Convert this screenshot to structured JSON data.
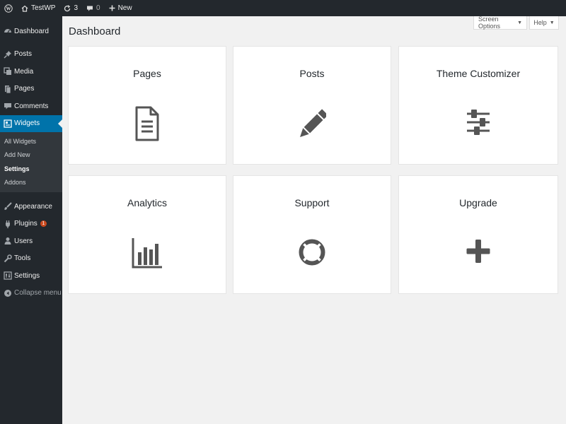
{
  "adminbar": {
    "site_name": "TestWP",
    "updates_count": "3",
    "comments_count": "0",
    "new_label": "New"
  },
  "sidebar": {
    "items_top": [
      {
        "label": "Dashboard",
        "icon": "dashboard-icon"
      },
      {
        "label": "Posts",
        "icon": "pin-icon"
      },
      {
        "label": "Media",
        "icon": "media-icon"
      },
      {
        "label": "Pages",
        "icon": "pages-icon"
      },
      {
        "label": "Comments",
        "icon": "comment-icon"
      },
      {
        "label": "Widgets",
        "icon": "widgets-icon",
        "active": true
      }
    ],
    "submenu": [
      {
        "label": "All Widgets"
      },
      {
        "label": "Add New"
      },
      {
        "label": "Settings",
        "current": true
      },
      {
        "label": "Addons"
      }
    ],
    "items_bottom": [
      {
        "label": "Appearance",
        "icon": "brush-icon"
      },
      {
        "label": "Plugins",
        "icon": "plug-icon",
        "badge": "1"
      },
      {
        "label": "Users",
        "icon": "user-icon"
      },
      {
        "label": "Tools",
        "icon": "wrench-icon"
      },
      {
        "label": "Settings",
        "icon": "settings-icon"
      },
      {
        "label": "Collapse menu",
        "icon": "collapse-icon"
      }
    ]
  },
  "header": {
    "screen_options_label": "Screen Options",
    "help_label": "Help",
    "title": "Dashboard"
  },
  "cards": [
    {
      "title": "Pages",
      "icon": "document-icon"
    },
    {
      "title": "Posts",
      "icon": "pencil-icon"
    },
    {
      "title": "Theme Customizer",
      "icon": "sliders-icon"
    },
    {
      "title": "Analytics",
      "icon": "bar-chart-icon"
    },
    {
      "title": "Support",
      "icon": "lifebuoy-icon"
    },
    {
      "title": "Upgrade",
      "icon": "plus-icon"
    }
  ],
  "colors": {
    "admin_bg": "#23282d",
    "active": "#0073aa",
    "content_bg": "#f1f1f1",
    "icon": "#555555",
    "badge": "#ca4a1f"
  }
}
